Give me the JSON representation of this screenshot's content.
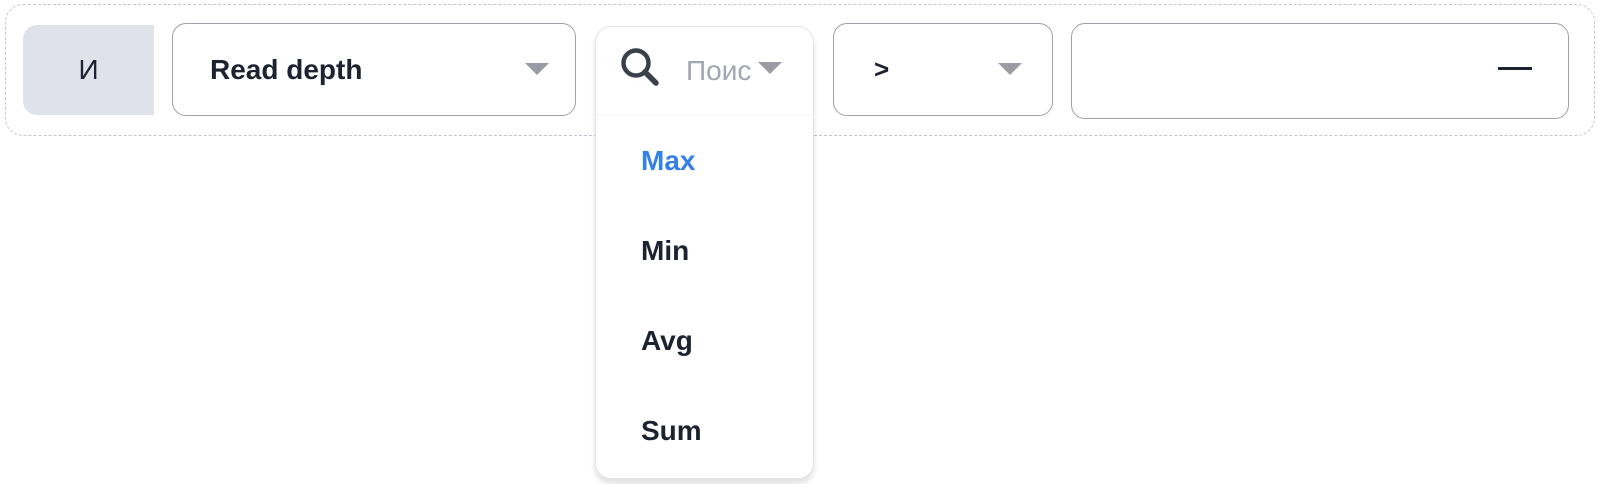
{
  "filter": {
    "conjunction": "И",
    "field": {
      "value": "Read depth",
      "caret_icon": "caret-down-icon"
    },
    "aggregation": {
      "search_icon": "search-icon",
      "search_placeholder": "Поиск",
      "search_value": "",
      "caret_icon": "caret-down-icon",
      "options": [
        {
          "label": "Max",
          "selected": true
        },
        {
          "label": "Min",
          "selected": false
        },
        {
          "label": "Avg",
          "selected": false
        },
        {
          "label": "Sum",
          "selected": false
        }
      ]
    },
    "operator": {
      "value": ">",
      "caret_icon": "caret-down-icon"
    },
    "value_input": {
      "value": "",
      "remove_icon": "minus-icon"
    }
  },
  "colors": {
    "accent": "#3381e8",
    "text": "#1c2230",
    "border": "#9fa1ad",
    "conjunction_bg": "#dfe2e9",
    "placeholder": "#a2a6b3"
  }
}
